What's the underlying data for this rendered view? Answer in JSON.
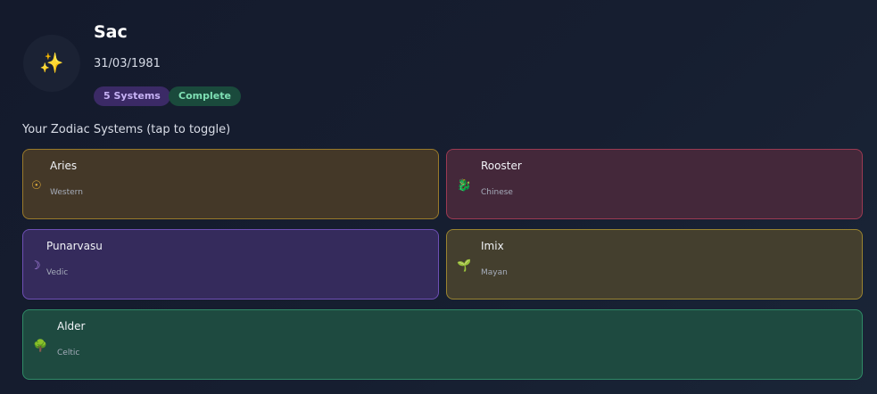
{
  "profile": {
    "avatar_icon": "sparkles-icon",
    "avatar_glyph": "✨",
    "name": "Sac",
    "birth_date": "31/03/1981",
    "badges": {
      "systems": "5 Systems",
      "status": "Complete"
    }
  },
  "section_title": "Your Zodiac Systems (tap to toggle)",
  "systems": [
    {
      "sign": "Aries",
      "system": "Western",
      "icon": "sun-icon",
      "glyph": "☉",
      "color": "#e8b23a"
    },
    {
      "sign": "Rooster",
      "system": "Chinese",
      "icon": "dragon-icon",
      "glyph": "🐉",
      "color": "#5bb58a"
    },
    {
      "sign": "Punarvasu",
      "system": "Vedic",
      "icon": "crescent-moon-icon",
      "glyph": "☽",
      "color": "#b58cf0"
    },
    {
      "sign": "Imix",
      "system": "Mayan",
      "icon": "seedling-icon",
      "glyph": "🌱",
      "color": "#7cc24a"
    },
    {
      "sign": "Alder",
      "system": "Celtic",
      "icon": "tree-icon",
      "glyph": "🌳",
      "color": "#5fb04a"
    }
  ]
}
